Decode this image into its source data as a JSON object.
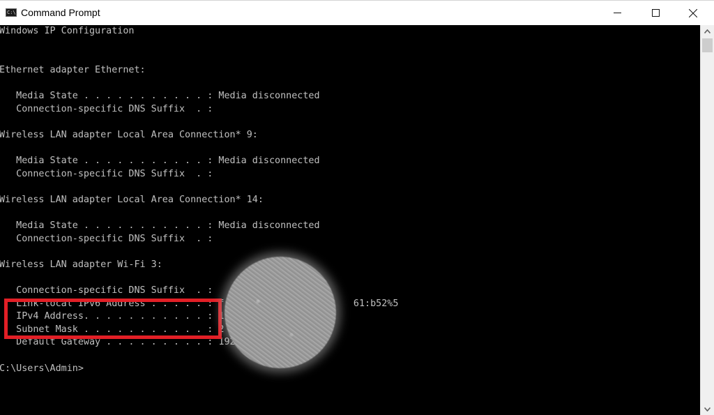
{
  "window": {
    "title": "Command Prompt",
    "icon": "cmd-icon",
    "icon_text": "C:\\.",
    "controls": {
      "minimize": "—",
      "maximize": "☐",
      "close": "✕"
    }
  },
  "console": {
    "lines": [
      "Windows IP Configuration",
      "",
      "",
      "Ethernet adapter Ethernet:",
      "",
      "   Media State . . . . . . . . . . . : Media disconnected",
      "   Connection-specific DNS Suffix  . :",
      "",
      "Wireless LAN adapter Local Area Connection* 9:",
      "",
      "   Media State . . . . . . . . . . . : Media disconnected",
      "   Connection-specific DNS Suffix  . :",
      "",
      "Wireless LAN adapter Local Area Connection* 14:",
      "",
      "   Media State . . . . . . . . . . . : Media disconnected",
      "   Connection-specific DNS Suffix  . :",
      "",
      "Wireless LAN adapter Wi-Fi 3:",
      "",
      "   Connection-specific DNS Suffix  . :",
      "   Link-local IPv6 Address . . . . . : f                       61:b52%5",
      "   IPv4 Address. . . . . . . . . . . : 1",
      "   Subnet Mask . . . . . . . . . . . : 2",
      "   Default Gateway . . . . . . . . . : 192",
      "",
      "C:\\Users\\Admin>"
    ]
  },
  "scrollbar": {
    "up_arrow": "˄",
    "down_arrow": "˅"
  },
  "annotations": {
    "highlight_color": "#e21f26",
    "highlighted_fields": [
      "Link-local IPv6 Address",
      "IPv4 Address",
      "Subnet Mask"
    ],
    "redaction": "blurred-noise-circle"
  }
}
